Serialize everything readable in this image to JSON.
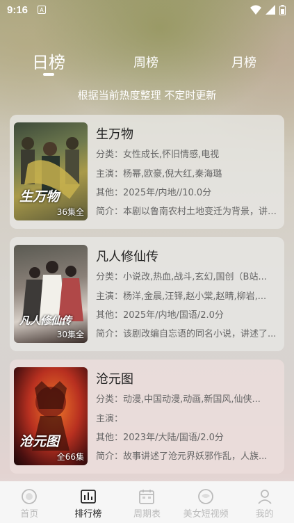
{
  "status": {
    "time": "9:16"
  },
  "tabs": [
    {
      "label": "日榜",
      "active": true
    },
    {
      "label": "周榜",
      "active": false
    },
    {
      "label": "月榜",
      "active": false
    }
  ],
  "subtitle": "根据当前热度整理 不定时更新",
  "cards": [
    {
      "title": "生万物",
      "poster_text": "生万物",
      "episodes": "36集全",
      "category": "分类：女性成长,怀旧情感,电视",
      "cast": "主演：杨幂,欧豪,倪大红,秦海璐",
      "other": "其他：2025年/内地//10.0分",
      "intro": "简介：本剧以鲁南农村土地变迁为背景，讲述了..."
    },
    {
      "title": "凡人修仙传",
      "poster_text": "凡人修仙传",
      "episodes": "30集全",
      "category": "分类：小说改,热血,战斗,玄幻,国创（B站...",
      "cast": "主演：杨洋,金晨,汪铎,赵小棠,赵晴,柳岩,...",
      "other": "其他：2025年/内地/国语/2.0分",
      "intro": "简介：该剧改编自忘语的同名小说，讲述了..."
    },
    {
      "title": "沧元图",
      "poster_text": "沧元图",
      "episodes": "全66集",
      "category": "分类：动漫,中国动漫,动画,新国风,仙侠...",
      "cast": "主演：",
      "other": "其他：2023年/大陆/国语/2.0分",
      "intro": "简介：故事讲述了沧元界妖邪作乱，人族..."
    }
  ],
  "nav": [
    {
      "label": "首页",
      "icon": "home-icon"
    },
    {
      "label": "排行榜",
      "icon": "ranking-icon"
    },
    {
      "label": "周期表",
      "icon": "calendar-icon"
    },
    {
      "label": "美女短视频",
      "icon": "video-icon"
    },
    {
      "label": "我的",
      "icon": "profile-icon"
    }
  ]
}
